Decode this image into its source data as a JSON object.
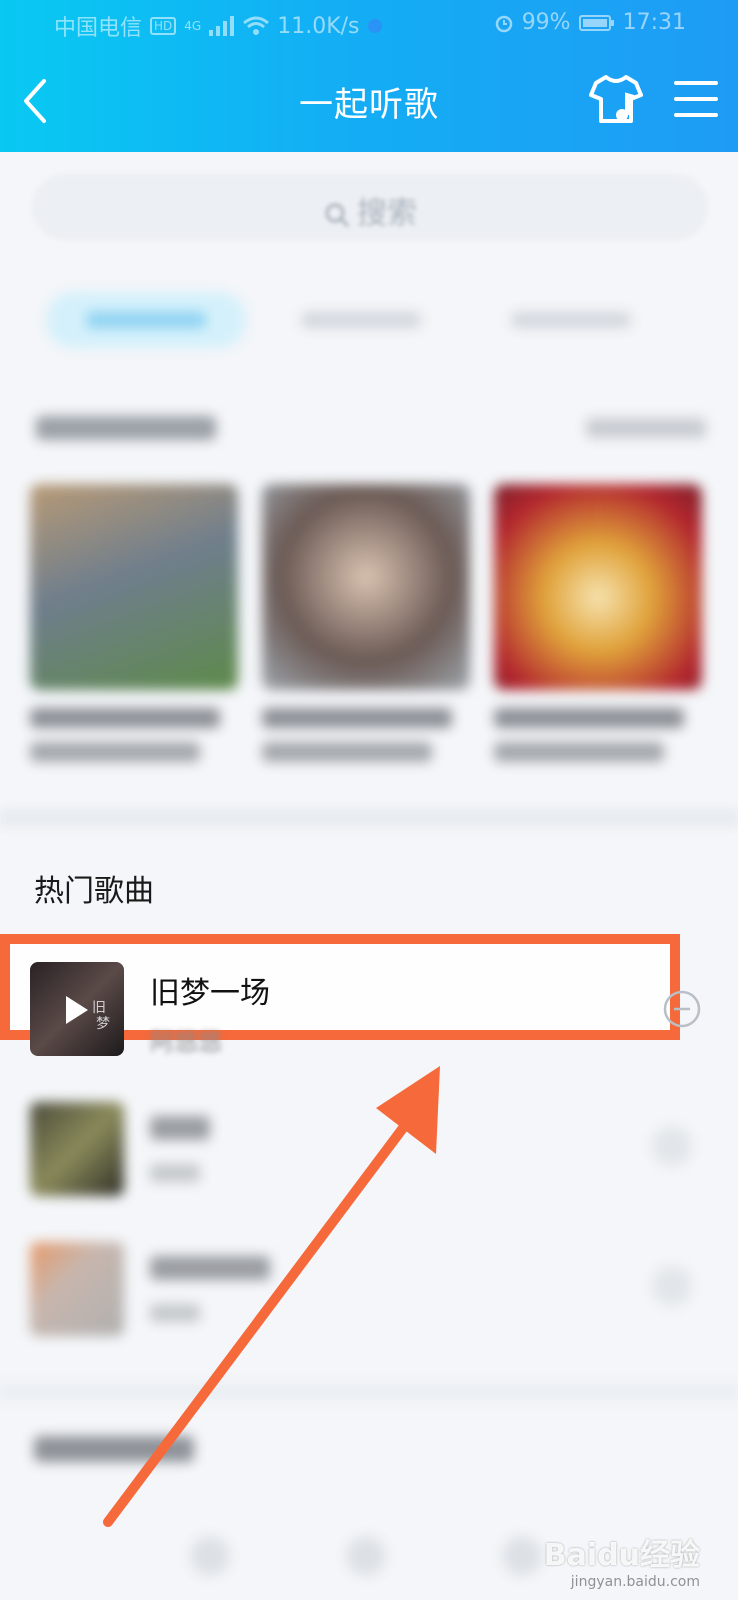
{
  "status_bar": {
    "carrier": "中国电信",
    "hd_badge": "HD",
    "network": "4G",
    "speed": "11.0K/s",
    "battery": "99%",
    "time": "17:31"
  },
  "navbar": {
    "title": "一起听歌",
    "icons": [
      "back-icon",
      "skin-tshirt-icon",
      "menu-icon"
    ]
  },
  "search": {
    "placeholder": "搜索"
  },
  "hot_songs": {
    "title": "热门歌曲",
    "items": [
      {
        "name": "旧梦一场",
        "artist": "阿悠悠",
        "thumb_text": "旧梦一场"
      }
    ]
  },
  "colors": {
    "header_start": "#08c9f2",
    "header_end": "#1e9cf5",
    "highlight": "#f5693a",
    "arrow": "#f5693a"
  },
  "watermark": {
    "brand": "Baidu经验",
    "url": "jingyan.baidu.com"
  }
}
